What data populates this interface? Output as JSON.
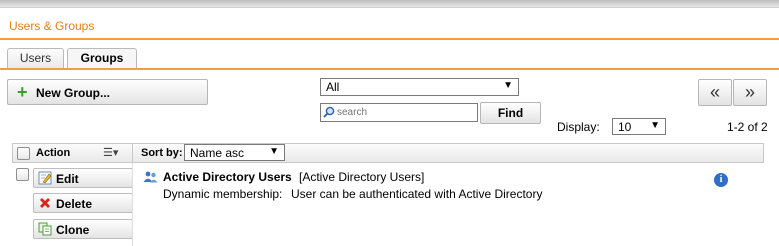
{
  "page": {
    "title": "Users & Groups"
  },
  "tabs": [
    {
      "label": "Users"
    },
    {
      "label": "Groups"
    }
  ],
  "toolbar": {
    "new_group_label": "New Group...",
    "filter_select_value": "All",
    "search_placeholder": "search",
    "find_label": "Find"
  },
  "pager": {
    "first_symbol": "«",
    "prev_symbol": "»",
    "display_label": "Display:",
    "display_value": "10",
    "count_text": "1-2 of 2"
  },
  "table": {
    "action_header": "Action",
    "sort_label": "Sort by:",
    "sort_value": "Name asc",
    "rows": [
      {
        "actions": {
          "edit": "Edit",
          "delete": "Delete",
          "clone": "Clone"
        },
        "name": "Active Directory Users",
        "type": "[Active Directory Users]",
        "membership_label": "Dynamic membership:",
        "membership_value": "User can be authenticated with Active Directory"
      }
    ]
  },
  "colors": {
    "accent": "#f0a036",
    "title": "#e0801d",
    "info": "#2f6fc4",
    "add": "#3a9d2b"
  }
}
